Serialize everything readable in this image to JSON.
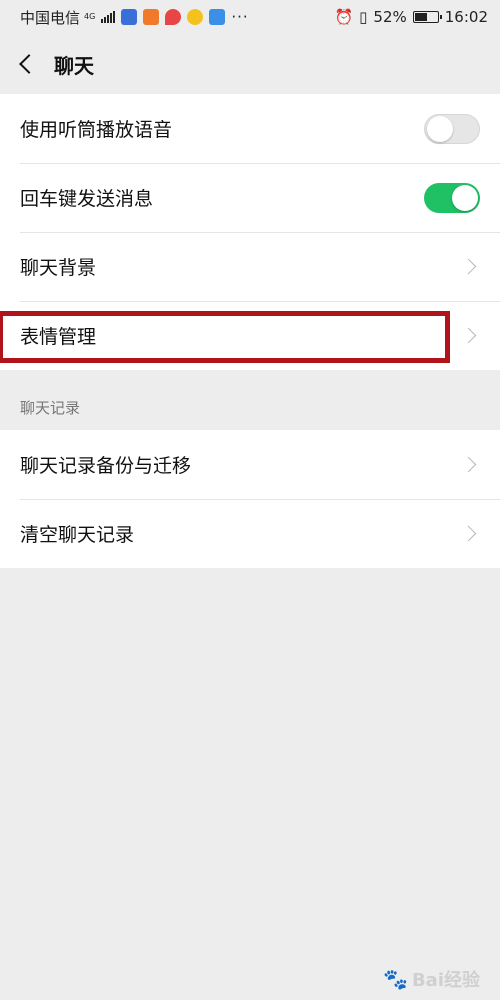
{
  "status_bar": {
    "carrier": "中国电信",
    "network": "4G",
    "battery_pct": "52%",
    "time": "16:02",
    "dots": "···"
  },
  "header": {
    "title": "聊天"
  },
  "settings": {
    "use_earpiece": {
      "label": "使用听筒播放语音",
      "enabled": false
    },
    "enter_to_send": {
      "label": "回车键发送消息",
      "enabled": true
    },
    "chat_background": {
      "label": "聊天背景"
    },
    "sticker_management": {
      "label": "表情管理"
    }
  },
  "chat_history_section": {
    "title": "聊天记录",
    "items": [
      {
        "label": "聊天记录备份与迁移"
      },
      {
        "label": "清空聊天记录"
      }
    ]
  },
  "watermark": {
    "text": "Bai经验"
  },
  "colors": {
    "toggle_on": "#20c064",
    "highlight": "#b0141a"
  }
}
